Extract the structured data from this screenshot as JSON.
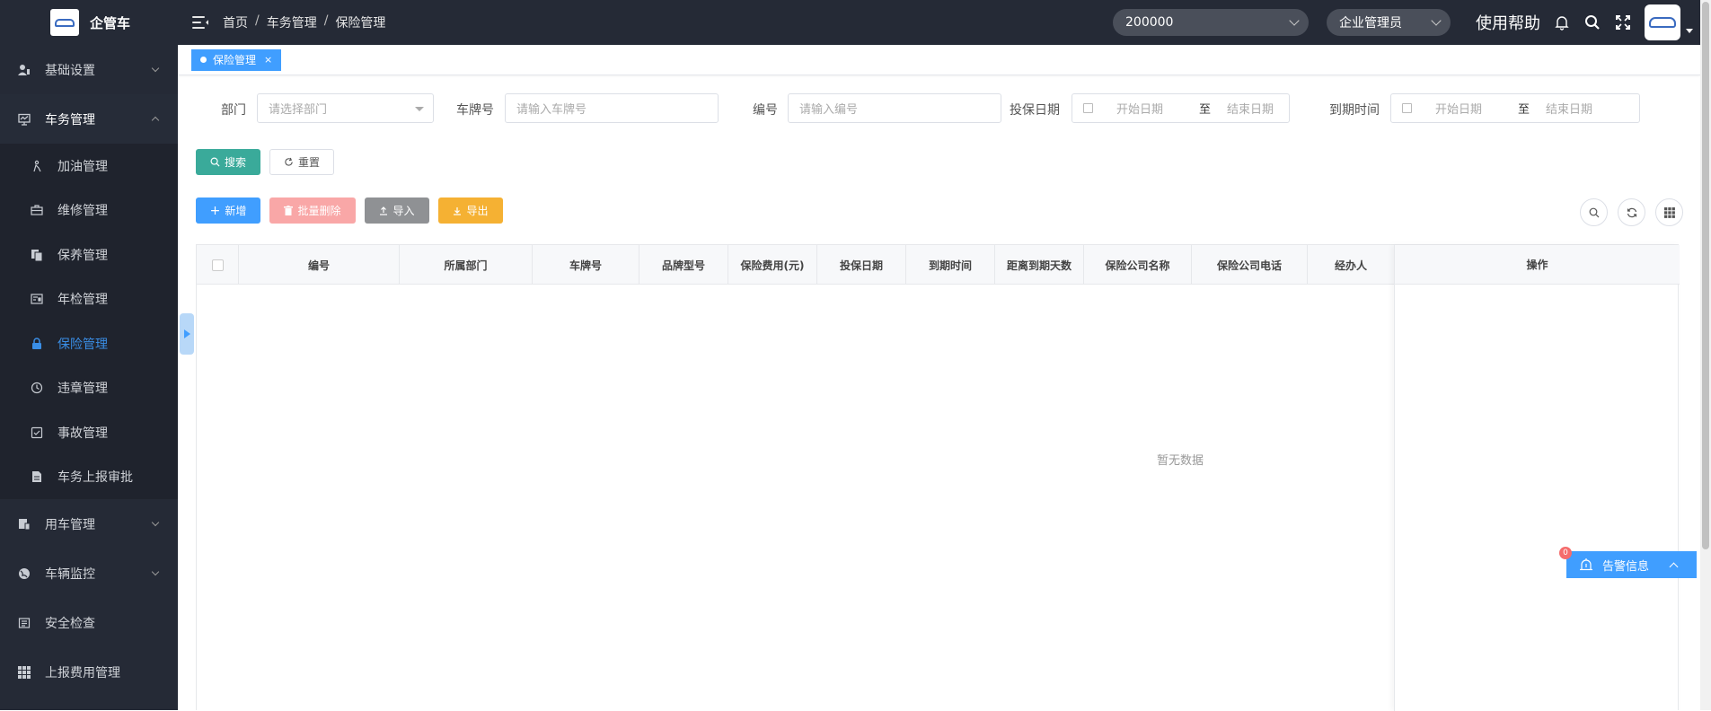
{
  "app": {
    "name": "企管车"
  },
  "header": {
    "breadcrumb": [
      "首页",
      "车务管理",
      "保险管理"
    ],
    "company_select": "200000",
    "role_select": "企业管理员",
    "help": "使用帮助"
  },
  "sidebar": {
    "groups": [
      {
        "label": "基础设置",
        "icon": "user-settings-icon"
      },
      {
        "label": "车务管理",
        "icon": "monitor-icon",
        "expanded": true
      },
      {
        "label": "用车管理",
        "icon": "car-use-icon"
      },
      {
        "label": "车辆监控",
        "icon": "globe-icon"
      },
      {
        "label": "安全检查",
        "icon": "checklist-icon"
      },
      {
        "label": "上报费用管理",
        "icon": "grid-icon"
      }
    ],
    "items": [
      {
        "label": "加油管理",
        "icon": "fuel-icon"
      },
      {
        "label": "维修管理",
        "icon": "toolbox-icon"
      },
      {
        "label": "保养管理",
        "icon": "documents-icon"
      },
      {
        "label": "年检管理",
        "icon": "inspection-icon"
      },
      {
        "label": "保险管理",
        "icon": "lock-icon",
        "active": true
      },
      {
        "label": "违章管理",
        "icon": "clock-icon"
      },
      {
        "label": "事故管理",
        "icon": "check-square-icon"
      },
      {
        "label": "车务上报审批",
        "icon": "file-icon"
      }
    ]
  },
  "tabs": [
    {
      "label": "保险管理",
      "closable": "×"
    }
  ],
  "filters": {
    "dept_label": "部门",
    "dept_placeholder": "请选择部门",
    "plate_label": "车牌号",
    "plate_placeholder": "请输入车牌号",
    "code_label": "编号",
    "code_placeholder": "请输入编号",
    "insure_date_label": "投保日期",
    "expire_label": "到期时间",
    "start_placeholder": "开始日期",
    "range_sep": "至",
    "end_placeholder": "结束日期"
  },
  "buttons": {
    "search": "搜索",
    "reset": "重置",
    "add": "新增",
    "batch_delete": "批量删除",
    "import": "导入",
    "export": "导出"
  },
  "table": {
    "columns": [
      "编号",
      "所属部门",
      "车牌号",
      "品牌型号",
      "保险费用(元)",
      "投保日期",
      "到期时间",
      "距离到期天数",
      "保险公司名称",
      "保险公司电话",
      "经办人",
      "操作"
    ],
    "empty_text": "暂无数据"
  },
  "alarm": {
    "label": "告警信息",
    "count": "0"
  },
  "colors": {
    "primary": "#409eff",
    "sidebar_bg": "#252a36",
    "success": "#3aaa9a",
    "danger_light": "#f9a7a7",
    "warning": "#f5b133"
  }
}
